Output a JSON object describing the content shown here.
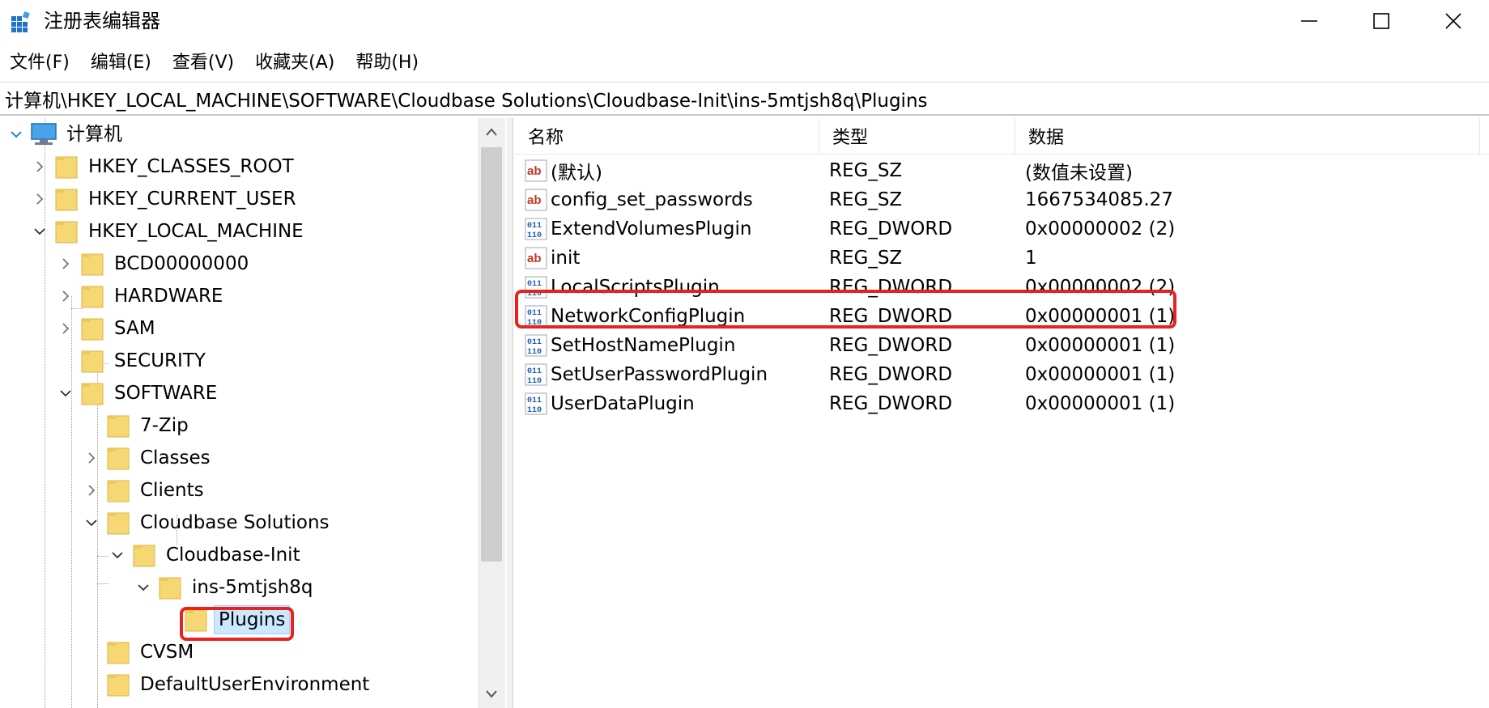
{
  "window": {
    "title": "注册表编辑器",
    "minimize_glyph": "—",
    "maximize_glyph": "☐",
    "close_glyph": "✕"
  },
  "menu": [
    "文件(F)",
    "编辑(E)",
    "查看(V)",
    "收藏夹(A)",
    "帮助(H)"
  ],
  "address": "计算机\\HKEY_LOCAL_MACHINE\\SOFTWARE\\Cloudbase Solutions\\Cloudbase-Init\\ins-5mtjsh8q\\Plugins",
  "tree": {
    "root": "计算机",
    "nodes": [
      {
        "label": "HKEY_CLASSES_ROOT",
        "state": "collapsed"
      },
      {
        "label": "HKEY_CURRENT_USER",
        "state": "collapsed"
      },
      {
        "label": "HKEY_LOCAL_MACHINE",
        "state": "expanded"
      },
      {
        "label": "BCD00000000",
        "state": "collapsed"
      },
      {
        "label": "HARDWARE",
        "state": "collapsed"
      },
      {
        "label": "SAM",
        "state": "collapsed"
      },
      {
        "label": "SECURITY",
        "state": "leaf"
      },
      {
        "label": "SOFTWARE",
        "state": "expanded"
      },
      {
        "label": "7-Zip",
        "state": "leaf"
      },
      {
        "label": "Classes",
        "state": "collapsed"
      },
      {
        "label": "Clients",
        "state": "collapsed"
      },
      {
        "label": "Cloudbase Solutions",
        "state": "expanded"
      },
      {
        "label": "Cloudbase-Init",
        "state": "expanded"
      },
      {
        "label": "ins-5mtjsh8q",
        "state": "expanded"
      },
      {
        "label": "Plugins",
        "state": "selected"
      },
      {
        "label": "CVSM",
        "state": "leaf"
      },
      {
        "label": "DefaultUserEnvironment",
        "state": "leaf"
      }
    ]
  },
  "list": {
    "columns": [
      "名称",
      "类型",
      "数据"
    ],
    "rows": [
      {
        "icon": "string-value-icon",
        "name": "(默认)",
        "type": "REG_SZ",
        "data": "(数值未设置)"
      },
      {
        "icon": "string-value-icon",
        "name": "config_set_passwords",
        "type": "REG_SZ",
        "data": "1667534085.27"
      },
      {
        "icon": "binary-value-icon",
        "name": "ExtendVolumesPlugin",
        "type": "REG_DWORD",
        "data": "0x00000002 (2)"
      },
      {
        "icon": "string-value-icon",
        "name": "init",
        "type": "REG_SZ",
        "data": "1"
      },
      {
        "icon": "binary-value-icon",
        "name": "LocalScriptsPlugin",
        "type": "REG_DWORD",
        "data": "0x00000002 (2)",
        "highlighted": true
      },
      {
        "icon": "binary-value-icon",
        "name": "NetworkConfigPlugin",
        "type": "REG_DWORD",
        "data": "0x00000001 (1)"
      },
      {
        "icon": "binary-value-icon",
        "name": "SetHostNamePlugin",
        "type": "REG_DWORD",
        "data": "0x00000001 (1)"
      },
      {
        "icon": "binary-value-icon",
        "name": "SetUserPasswordPlugin",
        "type": "REG_DWORD",
        "data": "0x00000001 (1)"
      },
      {
        "icon": "binary-value-icon",
        "name": "UserDataPlugin",
        "type": "REG_DWORD",
        "data": "0x00000001 (1)"
      }
    ]
  },
  "colors": {
    "highlight": "#e8221e",
    "folder": "#f7d774",
    "selection": "#cce8ff"
  }
}
